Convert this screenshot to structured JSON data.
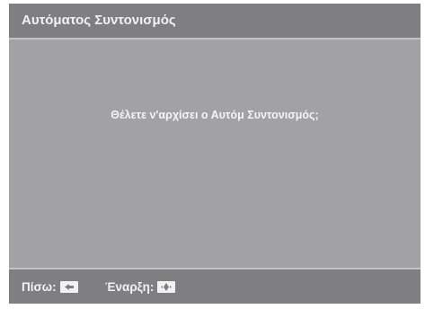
{
  "dialog": {
    "title": "Αυτόματος Συντονισμός",
    "message": "Θέλετε ν'αρχίσει ο Αυτόμ Συντονισμός;"
  },
  "footer": {
    "back_label": "Πίσω:",
    "back_key_icon": "left-arrow-key-icon",
    "start_label": "Έναρξη:",
    "start_key_icon": "enter-key-icon"
  },
  "colors": {
    "panel": "#a2a2a4",
    "bars": "#7f7f81",
    "text": "#f2f2f2"
  }
}
